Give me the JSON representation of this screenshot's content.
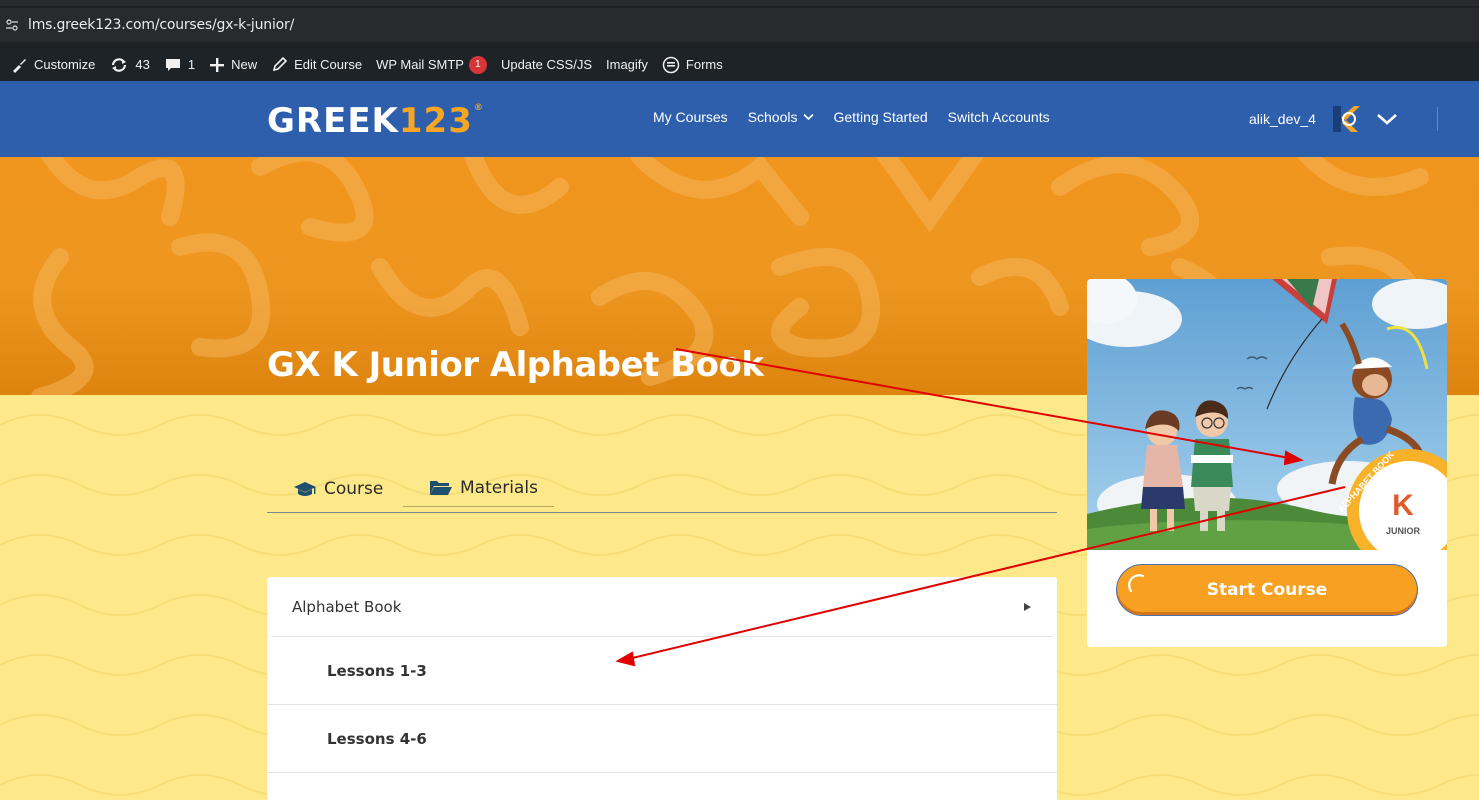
{
  "browser": {
    "url": "lms.greek123.com/courses/gx-k-junior/"
  },
  "adminbar": {
    "customize": "Customize",
    "updates_count": "43",
    "comments_count": "1",
    "new": "New",
    "edit_course": "Edit Course",
    "wp_mail_smtp": "WP Mail SMTP",
    "wp_mail_badge": "1",
    "update_css_js": "Update CSS/JS",
    "imagify": "Imagify",
    "forms": "Forms"
  },
  "header": {
    "logo_text": "GREEK",
    "logo_number": "123",
    "logo_reg": "®",
    "nav": [
      "My Courses",
      "Schools",
      "Getting Started",
      "Switch Accounts"
    ],
    "username": "alik_dev_4"
  },
  "course": {
    "title": "GX K Junior Alphabet Book",
    "tabs": {
      "course": "Course",
      "materials": "Materials"
    },
    "section": "Alphabet Book",
    "lessons": [
      "Lessons 1-3",
      "Lessons 4-6"
    ]
  },
  "card": {
    "cover_band": "ALPHABET BOOK",
    "cover_letter": "K",
    "cover_level": "JUNIOR",
    "start_button": "Start Course"
  },
  "colors": {
    "header_blue": "#2e5fad",
    "hero_orange": "#f0951e",
    "page_yellow": "#fde98a",
    "button_orange": "#f7a021",
    "annotation_red": "#e00000"
  }
}
